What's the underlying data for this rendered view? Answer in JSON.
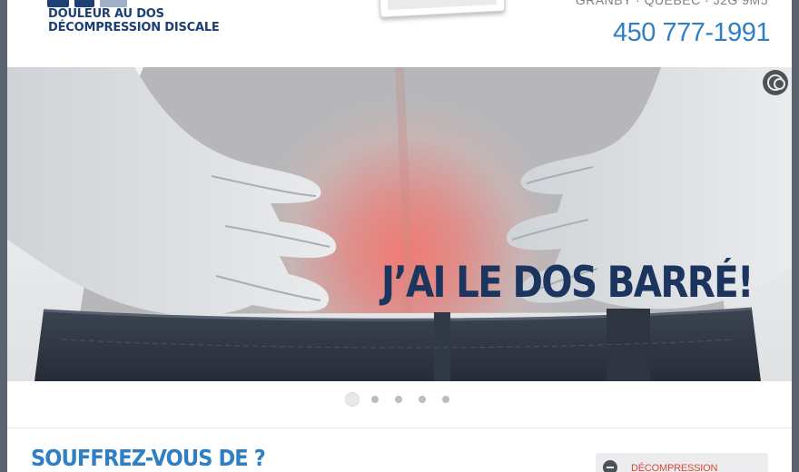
{
  "header": {
    "logo_line1": "DOULEUR AU DOS",
    "logo_line2": "DÉCOMPRESSION DISCALE",
    "address": "GRANBY · QUÉBEC · J2G 9M5",
    "phone": "450 777-1991"
  },
  "hero": {
    "tagline": "J’AI LE DOS BARRÉ!",
    "pause_icon": "pause-icon",
    "slide_count": 5,
    "active_slide": 1
  },
  "section": {
    "title": "SOUFFREZ-VOUS DE ?",
    "sidebar_button_label": "DÉCOMPRESSION VERTÉBRALE",
    "sidebar_button_icon": "minus-circle-icon"
  },
  "colors": {
    "brand_navy": "#1d3f73",
    "accent_blue": "#2f7fc4",
    "alert_red": "#d44a3a"
  }
}
